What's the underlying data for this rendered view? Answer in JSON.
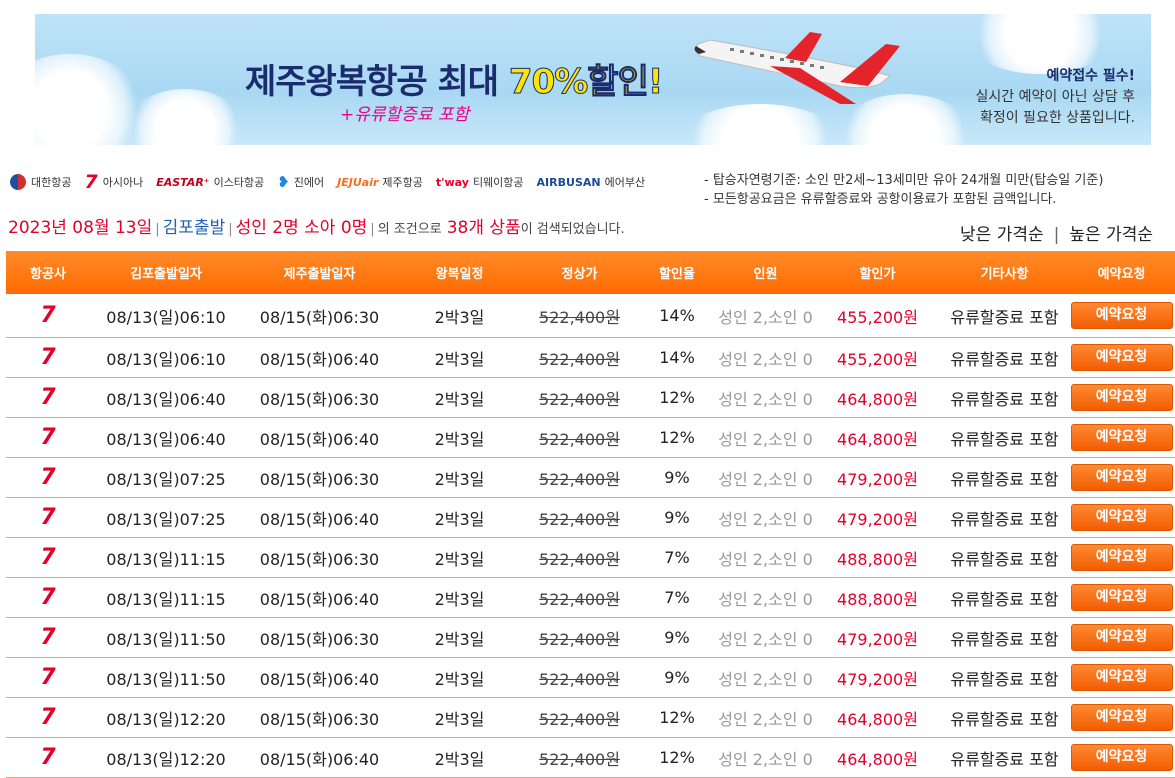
{
  "banner": {
    "title_prefix": "제주왕복항공 최대 ",
    "title_highlight": "70%할인!",
    "subtitle": "+유류할증료 포함",
    "note_line1": "예약접수 필수!",
    "note_line2": "실시간 예약이 아닌 상담 후",
    "note_line3": "확정이 필요한 상품입니다."
  },
  "airlines": [
    {
      "brand": "",
      "name": "대한항공",
      "icon": "korean-air-icon"
    },
    {
      "brand": "",
      "name": "아시아나",
      "icon": "asiana-icon"
    },
    {
      "brand": "EASTAR⁺",
      "name": "이스타항공",
      "icon": "eastar-icon"
    },
    {
      "brand": "",
      "name": "진에어",
      "icon": "jinair-icon"
    },
    {
      "brand": "JEJUair",
      "name": "제주항공",
      "icon": "jejuair-icon"
    },
    {
      "brand": "t'way",
      "name": "티웨이항공",
      "icon": "tway-icon"
    },
    {
      "brand": "AIRBUSAN",
      "name": "에어부산",
      "icon": "airbusan-icon"
    }
  ],
  "conditions": {
    "line1": "- 탑승자연령기준: 소인 만2세~13세미만 유아 24개월 미만(탑승일 기준)",
    "line2": "- 모든항공요금은 유류할증료와 공항이용료가 포함된 금액입니다."
  },
  "summary": {
    "date": "2023년 08월 13일",
    "departure": "김포출발",
    "pax": "성인 2명 소아 0명",
    "middle": "의 조건으로",
    "count": "38개 상품",
    "suffix": "이 검색되었습니다."
  },
  "sort": {
    "low": "낮은 가격순",
    "sep": "|",
    "high": "높은 가격순"
  },
  "table": {
    "headers": [
      "항공사",
      "김포출발일자",
      "제주출발일자",
      "왕복일정",
      "정상가",
      "할인율",
      "인원",
      "할인가",
      "기타사항",
      "예약요청"
    ],
    "rows": [
      {
        "airline_icon": "asiana-icon",
        "out": "08/13(일)06:10",
        "ret": "08/15(화)06:30",
        "sched": "2박3일",
        "normal": "522,400원",
        "rate": "14%",
        "pax": "성인 2,소인 0",
        "price": "455,200원",
        "note": "유류할증료 포함",
        "btn": "예약요청"
      },
      {
        "airline_icon": "asiana-icon",
        "out": "08/13(일)06:10",
        "ret": "08/15(화)06:40",
        "sched": "2박3일",
        "normal": "522,400원",
        "rate": "14%",
        "pax": "성인 2,소인 0",
        "price": "455,200원",
        "note": "유류할증료 포함",
        "btn": "예약요청"
      },
      {
        "airline_icon": "asiana-icon",
        "out": "08/13(일)06:40",
        "ret": "08/15(화)06:30",
        "sched": "2박3일",
        "normal": "522,400원",
        "rate": "12%",
        "pax": "성인 2,소인 0",
        "price": "464,800원",
        "note": "유류할증료 포함",
        "btn": "예약요청"
      },
      {
        "airline_icon": "asiana-icon",
        "out": "08/13(일)06:40",
        "ret": "08/15(화)06:40",
        "sched": "2박3일",
        "normal": "522,400원",
        "rate": "12%",
        "pax": "성인 2,소인 0",
        "price": "464,800원",
        "note": "유류할증료 포함",
        "btn": "예약요청"
      },
      {
        "airline_icon": "asiana-icon",
        "out": "08/13(일)07:25",
        "ret": "08/15(화)06:30",
        "sched": "2박3일",
        "normal": "522,400원",
        "rate": "9%",
        "pax": "성인 2,소인 0",
        "price": "479,200원",
        "note": "유류할증료 포함",
        "btn": "예약요청"
      },
      {
        "airline_icon": "asiana-icon",
        "out": "08/13(일)07:25",
        "ret": "08/15(화)06:40",
        "sched": "2박3일",
        "normal": "522,400원",
        "rate": "9%",
        "pax": "성인 2,소인 0",
        "price": "479,200원",
        "note": "유류할증료 포함",
        "btn": "예약요청"
      },
      {
        "airline_icon": "asiana-icon",
        "out": "08/13(일)11:15",
        "ret": "08/15(화)06:30",
        "sched": "2박3일",
        "normal": "522,400원",
        "rate": "7%",
        "pax": "성인 2,소인 0",
        "price": "488,800원",
        "note": "유류할증료 포함",
        "btn": "예약요청"
      },
      {
        "airline_icon": "asiana-icon",
        "out": "08/13(일)11:15",
        "ret": "08/15(화)06:40",
        "sched": "2박3일",
        "normal": "522,400원",
        "rate": "7%",
        "pax": "성인 2,소인 0",
        "price": "488,800원",
        "note": "유류할증료 포함",
        "btn": "예약요청"
      },
      {
        "airline_icon": "asiana-icon",
        "out": "08/13(일)11:50",
        "ret": "08/15(화)06:30",
        "sched": "2박3일",
        "normal": "522,400원",
        "rate": "9%",
        "pax": "성인 2,소인 0",
        "price": "479,200원",
        "note": "유류할증료 포함",
        "btn": "예약요청"
      },
      {
        "airline_icon": "asiana-icon",
        "out": "08/13(일)11:50",
        "ret": "08/15(화)06:40",
        "sched": "2박3일",
        "normal": "522,400원",
        "rate": "9%",
        "pax": "성인 2,소인 0",
        "price": "479,200원",
        "note": "유류할증료 포함",
        "btn": "예약요청"
      },
      {
        "airline_icon": "asiana-icon",
        "out": "08/13(일)12:20",
        "ret": "08/15(화)06:30",
        "sched": "2박3일",
        "normal": "522,400원",
        "rate": "12%",
        "pax": "성인 2,소인 0",
        "price": "464,800원",
        "note": "유류할증료 포함",
        "btn": "예약요청"
      },
      {
        "airline_icon": "asiana-icon",
        "out": "08/13(일)12:20",
        "ret": "08/15(화)06:40",
        "sched": "2박3일",
        "normal": "522,400원",
        "rate": "12%",
        "pax": "성인 2,소인 0",
        "price": "464,800원",
        "note": "유류할증료 포함",
        "btn": "예약요청"
      }
    ]
  },
  "colors": {
    "accent": "#ff6a00",
    "price": "#e4002b",
    "blue": "#1e5fb3"
  }
}
